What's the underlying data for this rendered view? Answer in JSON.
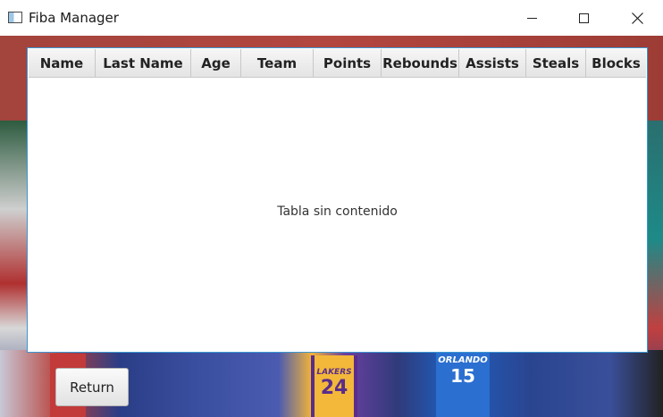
{
  "window": {
    "title": "Fiba Manager",
    "controls": [
      "minimize",
      "maximize",
      "close"
    ]
  },
  "table": {
    "columns": [
      "Name",
      "Last Name",
      "Age",
      "Team",
      "Points",
      "Rebounds",
      "Assists",
      "Steals",
      "Blocks"
    ],
    "rows": [],
    "empty_message": "Tabla sin contenido"
  },
  "background": {
    "jersey_lakers_text": "LAKERS",
    "jersey_lakers_number": "24",
    "jersey_orlando_text": "ORLANDO",
    "jersey_orlando_number": "15"
  },
  "actions": {
    "return_label": "Return"
  },
  "colors": {
    "table_border": "#3b97d3",
    "header_bg": "#e9e9e9",
    "titlebar_bg": "#ffffff"
  }
}
